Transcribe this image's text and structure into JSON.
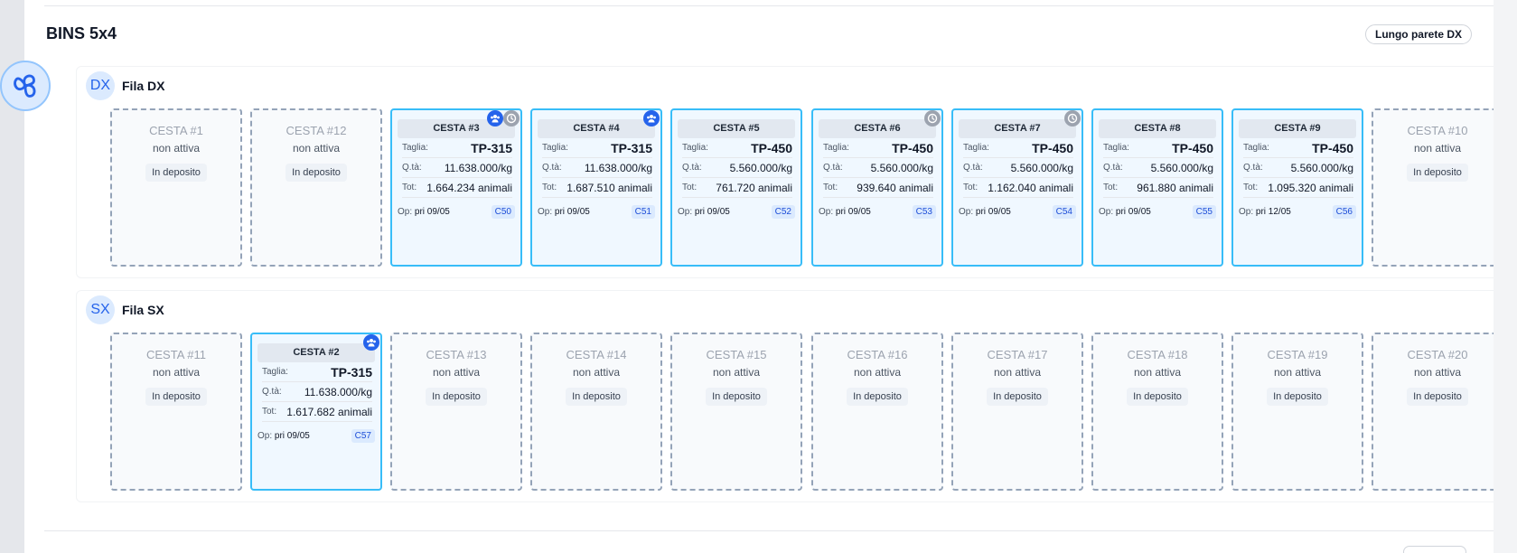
{
  "section": {
    "title": "BINS 5x4",
    "wall_label": "Lungo parete DX"
  },
  "rows": {
    "dx": {
      "badge": "DX",
      "name": "Fila DX",
      "bins": [
        {
          "title": "CESTA #1",
          "status": "non attiva",
          "deposit": "In deposito"
        },
        {
          "title": "CESTA #12",
          "status": "non attiva",
          "deposit": "In deposito"
        },
        {
          "title": "CESTA #3",
          "taglia": "TP-315",
          "qta": "11.638.000/kg",
          "tot": "1.664.234 animali",
          "op_date": "pri 09/05",
          "code": "C50",
          "icons": [
            "group",
            "clock"
          ]
        },
        {
          "title": "CESTA #4",
          "taglia": "TP-315",
          "qta": "11.638.000/kg",
          "tot": "1.687.510 animali",
          "op_date": "pri 09/05",
          "code": "C51",
          "icons": [
            "group"
          ]
        },
        {
          "title": "CESTA #5",
          "taglia": "TP-450",
          "qta": "5.560.000/kg",
          "tot": "761.720 animali",
          "op_date": "pri 09/05",
          "code": "C52",
          "icons": []
        },
        {
          "title": "CESTA #6",
          "taglia": "TP-450",
          "qta": "5.560.000/kg",
          "tot": "939.640 animali",
          "op_date": "pri 09/05",
          "code": "C53",
          "icons": [
            "clock"
          ]
        },
        {
          "title": "CESTA #7",
          "taglia": "TP-450",
          "qta": "5.560.000/kg",
          "tot": "1.162.040 animali",
          "op_date": "pri 09/05",
          "code": "C54",
          "icons": [
            "clock"
          ]
        },
        {
          "title": "CESTA #8",
          "taglia": "TP-450",
          "qta": "5.560.000/kg",
          "tot": "961.880 animali",
          "op_date": "pri 09/05",
          "code": "C55",
          "icons": []
        },
        {
          "title": "CESTA #9",
          "taglia": "TP-450",
          "qta": "5.560.000/kg",
          "tot": "1.095.320 animali",
          "op_date": "pri 12/05",
          "code": "C56",
          "icons": []
        },
        {
          "title": "CESTA #10",
          "status": "non attiva",
          "deposit": "In deposito"
        }
      ]
    },
    "sx": {
      "badge": "SX",
      "name": "Fila SX",
      "bins": [
        {
          "title": "CESTA #11",
          "status": "non attiva",
          "deposit": "In deposito"
        },
        {
          "title": "CESTA #2",
          "taglia": "TP-315",
          "qta": "11.638.000/kg",
          "tot": "1.617.682 animali",
          "op_date": "pri 09/05",
          "code": "C57",
          "icons": [
            "group"
          ]
        },
        {
          "title": "CESTA #13",
          "status": "non attiva",
          "deposit": "In deposito"
        },
        {
          "title": "CESTA #14",
          "status": "non attiva",
          "deposit": "In deposito"
        },
        {
          "title": "CESTA #15",
          "status": "non attiva",
          "deposit": "In deposito"
        },
        {
          "title": "CESTA #16",
          "status": "non attiva",
          "deposit": "In deposito"
        },
        {
          "title": "CESTA #17",
          "status": "non attiva",
          "deposit": "In deposito"
        },
        {
          "title": "CESTA #18",
          "status": "non attiva",
          "deposit": "In deposito"
        },
        {
          "title": "CESTA #19",
          "status": "non attiva",
          "deposit": "In deposito"
        },
        {
          "title": "CESTA #20",
          "status": "non attiva",
          "deposit": "In deposito"
        }
      ]
    }
  },
  "labels": {
    "taglia": "Taglia:",
    "qta": "Q.tà:",
    "tot": "Tot:",
    "op": "Op:"
  },
  "colors": {
    "active_border": "#38bdf8",
    "inactive_border": "#94a3b8",
    "accent": "#2563eb"
  }
}
